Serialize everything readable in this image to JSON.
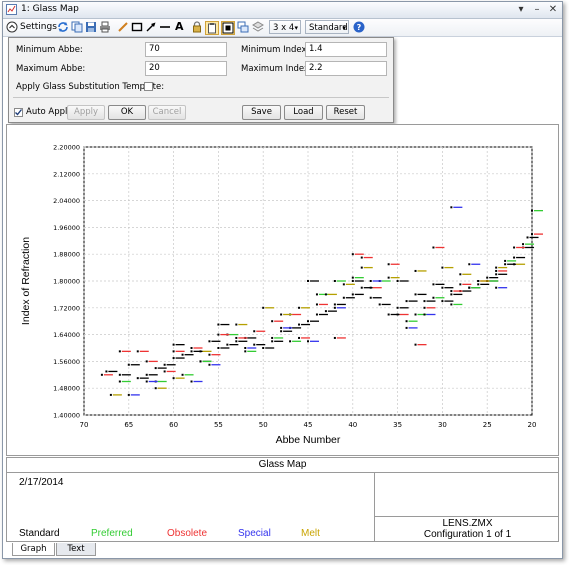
{
  "window": {
    "title": "1: Glass Map"
  },
  "toolbar": {
    "settings_label": "Settings",
    "layout_value": "3 x 4",
    "view_value": "Standard"
  },
  "settings": {
    "min_abbe_label": "Minimum Abbe:",
    "min_abbe_value": "70",
    "max_abbe_label": "Maximum Abbe:",
    "max_abbe_value": "20",
    "min_index_label": "Minimum Index:",
    "min_index_value": "1.4",
    "max_index_label": "Maximum Index:",
    "max_index_value": "2.2",
    "apply_template_label": "Apply Glass Substitution Template:",
    "auto_apply_label": "Auto Apply",
    "apply_label": "Apply",
    "ok_label": "OK",
    "cancel_label": "Cancel",
    "save_label": "Save",
    "load_label": "Load",
    "reset_label": "Reset"
  },
  "chart_data": {
    "type": "scatter",
    "xlabel": "Abbe Number",
    "ylabel": "Index of Refraction",
    "xlim": [
      70,
      20
    ],
    "ylim": [
      1.4,
      2.2
    ],
    "x_ticks": [
      "70",
      "65",
      "60",
      "55",
      "50",
      "45",
      "40",
      "35",
      "30",
      "25",
      "20"
    ],
    "y_ticks": [
      "1.40000",
      "1.48000",
      "1.56000",
      "1.64000",
      "1.72000",
      "1.80000",
      "1.88000",
      "1.96000",
      "2.04000",
      "2.12000",
      "2.20000"
    ],
    "grid": true,
    "series": [
      {
        "name": "Standard",
        "color": "#000000",
        "points": [
          [
            67.5,
            1.53
          ],
          [
            66,
            1.52
          ],
          [
            64,
            1.51
          ],
          [
            63,
            1.52
          ],
          [
            62,
            1.54
          ],
          [
            61,
            1.55
          ],
          [
            60,
            1.57
          ],
          [
            59,
            1.58
          ],
          [
            58,
            1.59
          ],
          [
            57,
            1.56
          ],
          [
            56,
            1.62
          ],
          [
            55,
            1.6
          ],
          [
            54,
            1.61
          ],
          [
            53,
            1.62
          ],
          [
            52,
            1.63
          ],
          [
            51,
            1.61
          ],
          [
            50,
            1.6
          ],
          [
            49,
            1.62
          ],
          [
            48,
            1.65
          ],
          [
            47,
            1.66
          ],
          [
            46,
            1.67
          ],
          [
            45,
            1.68
          ],
          [
            44,
            1.7
          ],
          [
            43,
            1.71
          ],
          [
            42,
            1.73
          ],
          [
            41,
            1.75
          ],
          [
            40,
            1.76
          ],
          [
            39,
            1.78
          ],
          [
            38,
            1.75
          ],
          [
            37,
            1.73
          ],
          [
            36,
            1.7
          ],
          [
            35,
            1.72
          ],
          [
            34,
            1.74
          ],
          [
            33,
            1.76
          ],
          [
            32,
            1.74
          ],
          [
            31,
            1.79
          ],
          [
            30,
            1.78
          ],
          [
            29,
            1.76
          ],
          [
            28,
            1.77
          ],
          [
            27,
            1.78
          ],
          [
            26,
            1.79
          ],
          [
            25,
            1.81
          ],
          [
            24,
            1.82
          ],
          [
            23,
            1.85
          ],
          [
            22,
            1.87
          ],
          [
            21,
            1.9
          ],
          [
            20.5,
            1.93
          ],
          [
            25,
            1.8
          ],
          [
            30,
            1.74
          ],
          [
            40,
            1.8
          ],
          [
            35,
            1.8
          ],
          [
            45,
            1.8
          ],
          [
            55,
            1.67
          ],
          [
            60,
            1.61
          ],
          [
            65,
            1.55
          ]
        ]
      },
      {
        "name": "Preferred",
        "color": "#33cc33",
        "points": [
          [
            66,
            1.5
          ],
          [
            62,
            1.5
          ],
          [
            59,
            1.52
          ],
          [
            57,
            1.56
          ],
          [
            54,
            1.64
          ],
          [
            52,
            1.59
          ],
          [
            49,
            1.63
          ],
          [
            47,
            1.62
          ],
          [
            44,
            1.76
          ],
          [
            42,
            1.8
          ],
          [
            40,
            1.81
          ],
          [
            37,
            1.8
          ],
          [
            34,
            1.68
          ],
          [
            33,
            1.7
          ],
          [
            31,
            1.75
          ],
          [
            29,
            1.73
          ],
          [
            27,
            1.78
          ],
          [
            25,
            1.8
          ],
          [
            23,
            1.86
          ],
          [
            21,
            1.91
          ],
          [
            20,
            2.01
          ]
        ]
      },
      {
        "name": "Obsolete",
        "color": "#ee3333",
        "points": [
          [
            68,
            1.52
          ],
          [
            66,
            1.59
          ],
          [
            64,
            1.59
          ],
          [
            63,
            1.56
          ],
          [
            61,
            1.53
          ],
          [
            60,
            1.59
          ],
          [
            58,
            1.6
          ],
          [
            56,
            1.58
          ],
          [
            55,
            1.64
          ],
          [
            53,
            1.63
          ],
          [
            51,
            1.65
          ],
          [
            49,
            1.68
          ],
          [
            47,
            1.7
          ],
          [
            46,
            1.63
          ],
          [
            44,
            1.73
          ],
          [
            42,
            1.63
          ],
          [
            40,
            1.88
          ],
          [
            39,
            1.87
          ],
          [
            38,
            1.78
          ],
          [
            36,
            1.85
          ],
          [
            35,
            1.7
          ],
          [
            33,
            1.61
          ],
          [
            32,
            1.72
          ],
          [
            31,
            1.9
          ],
          [
            29,
            1.77
          ],
          [
            28,
            1.79
          ],
          [
            26,
            1.8
          ],
          [
            24,
            1.83
          ],
          [
            22,
            1.9
          ],
          [
            20,
            1.94
          ]
        ]
      },
      {
        "name": "Special",
        "color": "#3333ee",
        "points": [
          [
            65,
            1.46
          ],
          [
            63,
            1.5
          ],
          [
            58,
            1.5
          ],
          [
            56,
            1.55
          ],
          [
            52,
            1.6
          ],
          [
            48,
            1.66
          ],
          [
            45,
            1.62
          ],
          [
            42,
            1.72
          ],
          [
            38,
            1.8
          ],
          [
            34,
            1.66
          ],
          [
            32,
            1.7
          ],
          [
            29,
            2.02
          ],
          [
            27,
            1.85
          ],
          [
            24,
            1.78
          ]
        ]
      },
      {
        "name": "Melt",
        "color": "#b5a000",
        "points": [
          [
            67,
            1.46
          ],
          [
            62,
            1.48
          ],
          [
            60,
            1.51
          ],
          [
            57,
            1.59
          ],
          [
            53,
            1.67
          ],
          [
            50,
            1.72
          ],
          [
            48,
            1.7
          ],
          [
            46,
            1.72
          ],
          [
            43,
            1.76
          ],
          [
            41,
            1.79
          ],
          [
            39,
            1.84
          ],
          [
            36,
            1.81
          ],
          [
            33,
            1.83
          ],
          [
            30,
            1.84
          ],
          [
            28,
            1.82
          ],
          [
            26,
            1.8
          ],
          [
            24,
            1.84
          ],
          [
            22,
            1.85
          ]
        ]
      }
    ]
  },
  "info": {
    "title": "Glass Map",
    "date": "2/17/2014",
    "file": "LENS.ZMX",
    "config": "Configuration 1 of 1",
    "legend": [
      {
        "label": "Standard",
        "color": "#000000"
      },
      {
        "label": "Preferred",
        "color": "#33cc33"
      },
      {
        "label": "Obsolete",
        "color": "#ee3333"
      },
      {
        "label": "Special",
        "color": "#3333ee"
      },
      {
        "label": "Melt",
        "color": "#c9a400"
      }
    ]
  },
  "tabs": [
    {
      "label": "Graph"
    },
    {
      "label": "Text"
    }
  ]
}
